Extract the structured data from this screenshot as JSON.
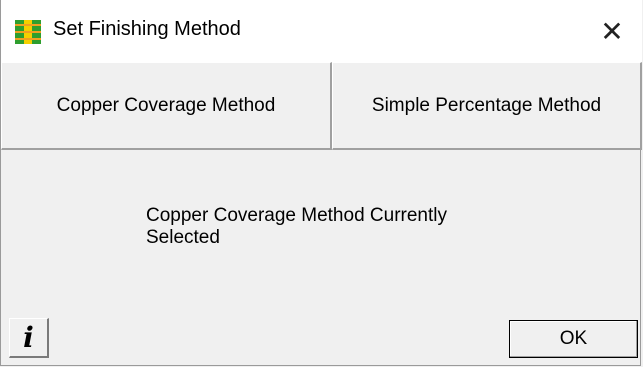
{
  "window": {
    "title": "Set Finishing Method",
    "close_glyph": "✕",
    "app_icon": "finishing-method-icon"
  },
  "methods": {
    "copper_label": "Copper Coverage Method",
    "simple_label": "Simple Percentage Method"
  },
  "status": {
    "line1": "Copper Coverage Method Currently",
    "line2": "Selected"
  },
  "footer": {
    "info_label": "i",
    "ok_label": "OK"
  },
  "colors": {
    "icon_green": "#2e9e2e",
    "icon_orange": "#f0a020",
    "icon_yellow": "#f5d000"
  }
}
